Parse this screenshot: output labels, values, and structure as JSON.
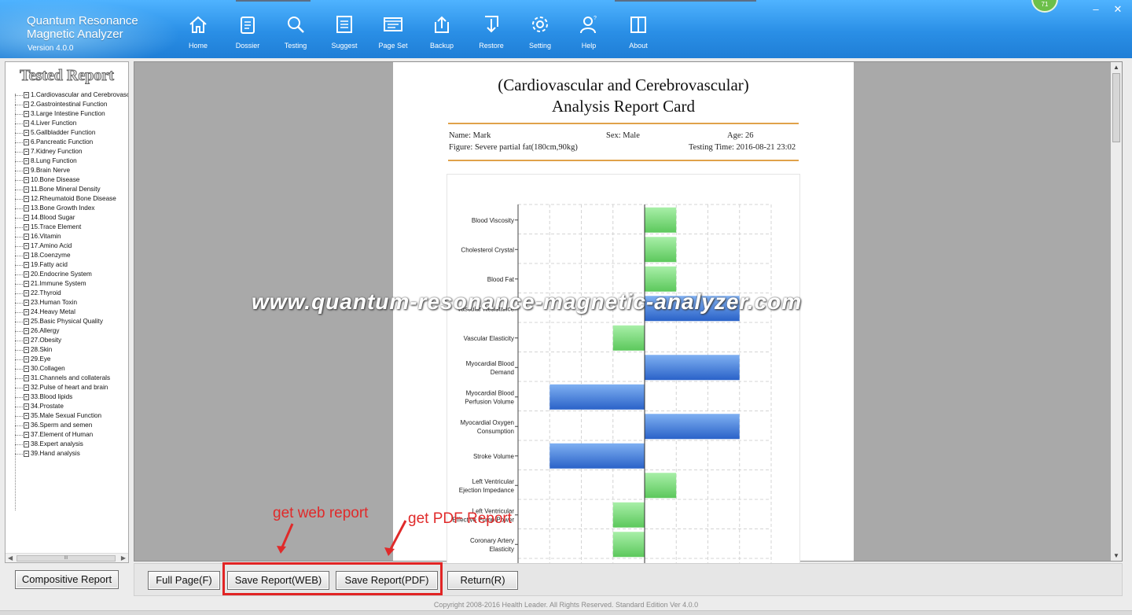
{
  "app": {
    "title_line1": "Quantum Resonance",
    "title_line2": "Magnetic Analyzer",
    "version": "Version 4.0.0",
    "badge": "71"
  },
  "nav": [
    {
      "label": "Home",
      "icon": "home-icon"
    },
    {
      "label": "Dossier",
      "icon": "clipboard-icon"
    },
    {
      "label": "Testing",
      "icon": "magnifier-icon"
    },
    {
      "label": "Suggest",
      "icon": "list-icon"
    },
    {
      "label": "Page Set",
      "icon": "page-icon"
    },
    {
      "label": "Backup",
      "icon": "upload-icon"
    },
    {
      "label": "Restore",
      "icon": "download-icon"
    },
    {
      "label": "Setting",
      "icon": "gear-icon"
    },
    {
      "label": "Help",
      "icon": "person-help-icon"
    },
    {
      "label": "About",
      "icon": "book-icon"
    }
  ],
  "window_controls": {
    "minimize": "–",
    "close": "✕"
  },
  "sidebar": {
    "title": "Tested Report",
    "items": [
      "1.Cardiovascular and Cerebrovasc",
      "2.Gastrointestinal Function",
      "3.Large Intestine Function",
      "4.Liver Function",
      "5.Gallbladder Function",
      "6.Pancreatic Function",
      "7.Kidney Function",
      "8.Lung Function",
      "9.Brain Nerve",
      "10.Bone Disease",
      "11.Bone Mineral Density",
      "12.Rheumatoid Bone Disease",
      "13.Bone Growth Index",
      "14.Blood Sugar",
      "15.Trace Element",
      "16.Vitamin",
      "17.Amino Acid",
      "18.Coenzyme",
      "19.Fatty acid",
      "20.Endocrine System",
      "21.Immune System",
      "22.Thyroid",
      "23.Human Toxin",
      "24.Heavy Metal",
      "25.Basic Physical Quality",
      "26.Allergy",
      "27.Obesity",
      "28.Skin",
      "29.Eye",
      "30.Collagen",
      "31.Channels and collaterals",
      "32.Pulse of heart and brain",
      "33.Blood lipids",
      "34.Prostate",
      "35.Male Sexual Function",
      "36.Sperm and semen",
      "37.Element of Human",
      "38.Expert analysis",
      "39.Hand analysis"
    ],
    "scroll_grip": "III",
    "compositive_button": "Compositive Report"
  },
  "report": {
    "title_line1": "(Cardiovascular and Cerebrovascular)",
    "title_line2": "Analysis Report Card",
    "name": "Name: Mark",
    "sex": "Sex: Male",
    "age": "Age: 26",
    "figure": "Figure: Severe partial fat(180cm,90kg)",
    "testing_time": "Testing Time: 2016-08-21 23:02"
  },
  "chart_data": {
    "type": "bar",
    "orientation": "horizontal",
    "categories": [
      [
        "Blood Viscosity"
      ],
      [
        "Cholesterol Crystal"
      ],
      [
        "Blood Fat"
      ],
      [
        "Vascular Resistance"
      ],
      [
        "Vascular Elasticity"
      ],
      [
        "Myocardial Blood",
        "Demand"
      ],
      [
        "Myocardial Blood",
        "Perfusion Volume"
      ],
      [
        "Myocardial Oxygen",
        "Consumption"
      ],
      [
        "Stroke Volume"
      ],
      [
        "Left Ventricular",
        "Ejection Impedance"
      ],
      [
        "Left Ventricular",
        "Effective Pump Power"
      ],
      [
        "Coronary Artery",
        "Elasticity"
      ]
    ],
    "values": [
      1,
      1,
      1,
      3,
      -1,
      3,
      -3,
      3,
      -3,
      1,
      -1,
      -1
    ],
    "xlim": [
      -4,
      4
    ],
    "grid": true,
    "colors": {
      "positive_small": "#7edc7e",
      "negative_small": "#7edc7e",
      "large": "#3a78d8"
    }
  },
  "watermark": "www.quantum-resonance-magnetic-analyzer.com",
  "toolbar": {
    "full_page": "Full Page(F)",
    "save_web": "Save Report(WEB)",
    "save_pdf": "Save Report(PDF)",
    "return": "Return(R)"
  },
  "annotations": {
    "web_note": "get web report",
    "pdf_note": "get PDF Report",
    "color": "#e02a2a"
  },
  "copyright": "Copyright 2008-2016 Health Leader. All Rights Reserved.  Standard Edition Ver 4.0.0"
}
